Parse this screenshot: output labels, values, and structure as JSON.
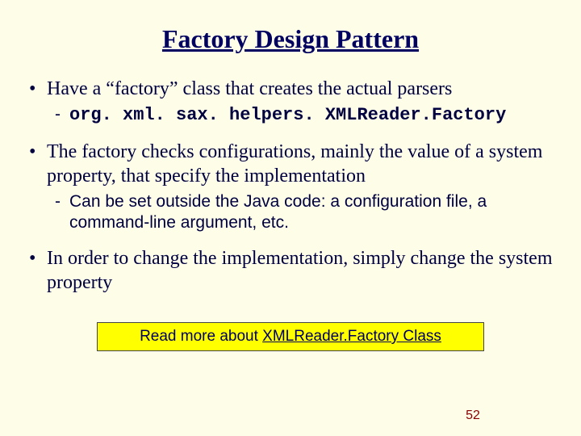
{
  "title": "Factory Design Pattern",
  "bullets": {
    "b1": {
      "text": "Have a “factory” class that creates the actual parsers",
      "sub1_code": "org. xml. sax. helpers. XMLReader.Factory"
    },
    "b2": {
      "text": "The factory checks configurations, mainly the value of a system property, that specify the implementation",
      "sub1": "Can be set outside the Java code: a configuration file, a command-line argument, etc."
    },
    "b3": {
      "text": "In order to change the implementation, simply change the system property"
    }
  },
  "readmore": {
    "prefix": "Read more about ",
    "link_text": "XMLReader.Factory Class"
  },
  "page_number": "52"
}
